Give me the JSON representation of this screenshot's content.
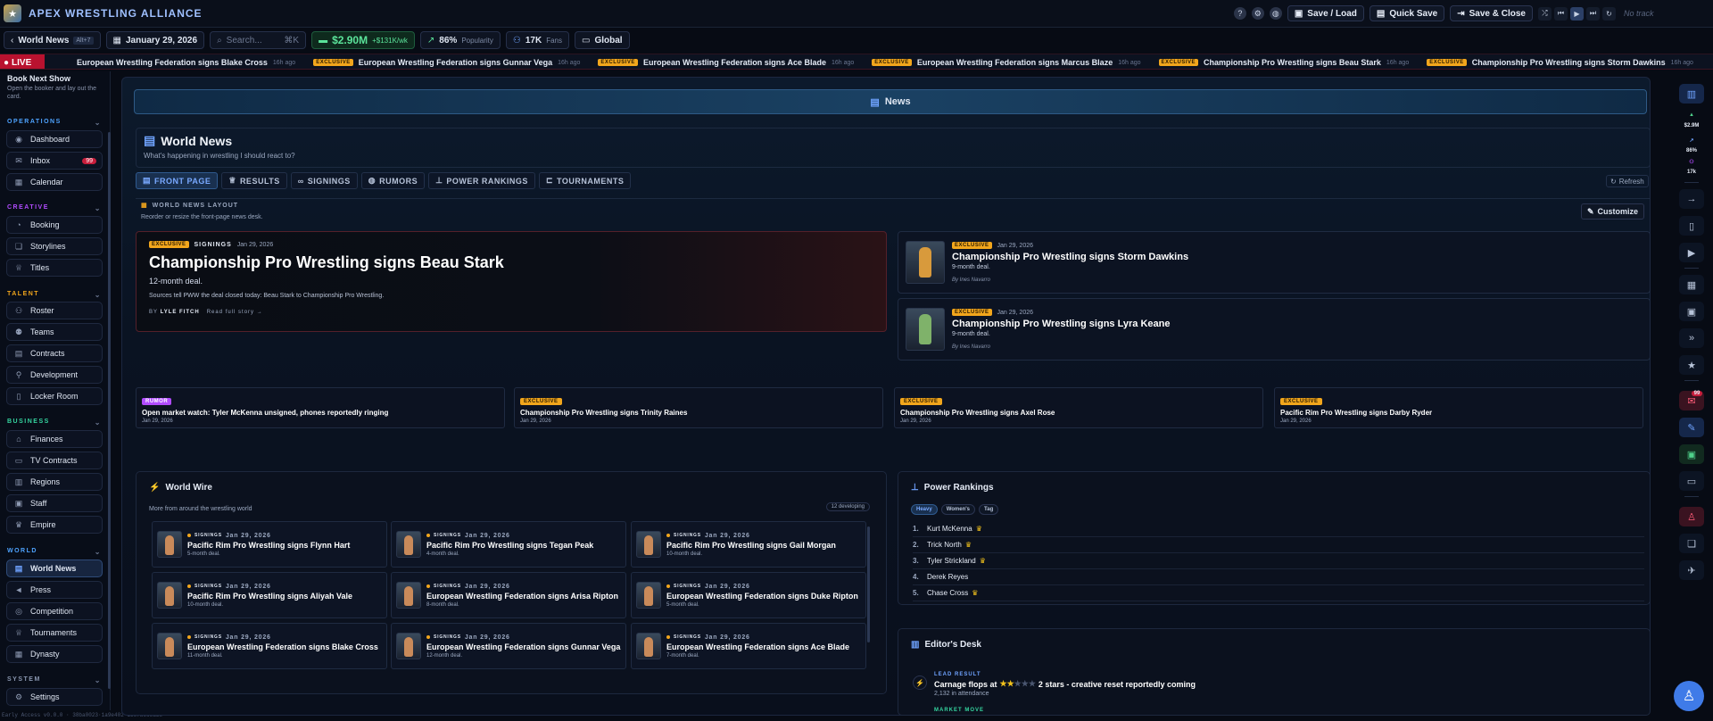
{
  "app": {
    "title": "APEX WRESTLING ALLIANCE"
  },
  "topbar": {
    "save_load": "Save / Load",
    "quick_save": "Quick Save",
    "save_close": "Save & Close",
    "track": "No track"
  },
  "statusbar": {
    "world_news": "World News",
    "shortcut": "Alt+7",
    "date": "January 29, 2026",
    "search_placeholder": "Search...",
    "search_kbd": "⌘K",
    "money": "$2.90M",
    "money_delta": "+$131K/wk",
    "popularity": "86%",
    "popularity_label": "Popularity",
    "fans": "17K",
    "fans_label": "Fans",
    "scope": "Global"
  },
  "ticker": {
    "live": "LIVE",
    "items": [
      {
        "tag": "",
        "text": "European Wrestling Federation signs Blake Cross",
        "ago": "16h ago"
      },
      {
        "tag": "EXCLUSIVE",
        "text": "European Wrestling Federation signs Gunnar Vega",
        "ago": "16h ago"
      },
      {
        "tag": "EXCLUSIVE",
        "text": "European Wrestling Federation signs Ace Blade",
        "ago": "16h ago"
      },
      {
        "tag": "EXCLUSIVE",
        "text": "European Wrestling Federation signs Marcus Blaze",
        "ago": "16h ago"
      },
      {
        "tag": "EXCLUSIVE",
        "text": "Championship Pro Wrestling signs Beau Stark",
        "ago": "16h ago"
      },
      {
        "tag": "EXCLUSIVE",
        "text": "Championship Pro Wrestling signs Storm Dawkins",
        "ago": "16h ago"
      }
    ]
  },
  "sidebar": {
    "book_title": "Book Next Show",
    "book_desc": "Open the booker and lay out the card.",
    "sections": {
      "operations": "OPERATIONS",
      "creative": "CREATIVE",
      "talent": "TALENT",
      "business": "BUSINESS",
      "world": "WORLD",
      "system": "SYSTEM"
    },
    "items": {
      "dashboard": "Dashboard",
      "inbox": "Inbox",
      "inbox_count": "99",
      "calendar": "Calendar",
      "booking": "Booking",
      "storylines": "Storylines",
      "titles": "Titles",
      "roster": "Roster",
      "teams": "Teams",
      "contracts": "Contracts",
      "development": "Development",
      "locker_room": "Locker Room",
      "finances": "Finances",
      "tv_contracts": "TV Contracts",
      "regions": "Regions",
      "staff": "Staff",
      "empire": "Empire",
      "world_news": "World News",
      "press": "Press",
      "competition": "Competition",
      "tournaments": "Tournaments",
      "dynasty": "Dynasty",
      "settings": "Settings"
    },
    "version": "Early Access v0.0.0 · 38ba0023·1a9e402·1387b6c9a38"
  },
  "rail": {
    "money": "$2.9M",
    "pop": "86%",
    "fans": "17k",
    "badge": "99"
  },
  "header": {
    "title": "News"
  },
  "worldnews": {
    "title": "World News",
    "subtitle": "What's happening in wrestling I should react to?",
    "tabs": [
      "FRONT PAGE",
      "RESULTS",
      "SIGNINGS",
      "RUMORS",
      "POWER RANKINGS",
      "TOURNAMENTS"
    ],
    "refresh": "Refresh",
    "layout_title": "WORLD NEWS LAYOUT",
    "layout_sub": "Reorder or resize the front-page news desk.",
    "customize": "Customize"
  },
  "hero": {
    "tag": "EXCLUSIVE",
    "cat": "SIGNINGS",
    "date": "Jan 29, 2026",
    "headline": "Championship Pro Wrestling signs Beau Stark",
    "deal": "12-month deal.",
    "lede": "Sources tell PWW the deal closed today: Beau Stark to Championship Pro Wrestling.",
    "by": "BY",
    "author": "LYLE FITCH",
    "read": "Read full story →"
  },
  "side_stories": [
    {
      "tag": "EXCLUSIVE",
      "date": "Jan 29, 2026",
      "headline": "Championship Pro Wrestling signs Storm Dawkins",
      "deal": "9-month deal.",
      "author": "By Ines Navarro"
    },
    {
      "tag": "EXCLUSIVE",
      "date": "Jan 29, 2026",
      "headline": "Championship Pro Wrestling signs Lyra Keane",
      "deal": "9-month deal.",
      "author": "By Ines Navarro"
    }
  ],
  "mini_stories": [
    {
      "tag": "RUMOR",
      "headline": "Open market watch: Tyler McKenna unsigned, phones reportedly ringing",
      "date": "Jan 29, 2026"
    },
    {
      "tag": "EXCLUSIVE",
      "headline": "Championship Pro Wrestling signs Trinity Raines",
      "date": "Jan 29, 2026"
    },
    {
      "tag": "EXCLUSIVE",
      "headline": "Championship Pro Wrestling signs Axel Rose",
      "date": "Jan 29, 2026"
    },
    {
      "tag": "EXCLUSIVE",
      "headline": "Pacific Rim Pro Wrestling signs Darby Ryder",
      "date": "Jan 29, 2026"
    }
  ],
  "wire": {
    "title": "World Wire",
    "subtitle": "More from around the wrestling world",
    "developing": "12 developing",
    "cards": [
      {
        "cat": "SIGNINGS",
        "date": "Jan 29, 2026",
        "headline": "Pacific Rim Pro Wrestling signs Flynn Hart",
        "deal": "5-month deal."
      },
      {
        "cat": "SIGNINGS",
        "date": "Jan 29, 2026",
        "headline": "Pacific Rim Pro Wrestling signs Tegan Peak",
        "deal": "4-month deal."
      },
      {
        "cat": "SIGNINGS",
        "date": "Jan 29, 2026",
        "headline": "Pacific Rim Pro Wrestling signs Gail Morgan",
        "deal": "10-month deal."
      },
      {
        "cat": "SIGNINGS",
        "date": "Jan 29, 2026",
        "headline": "Pacific Rim Pro Wrestling signs Aliyah Vale",
        "deal": "10-month deal."
      },
      {
        "cat": "SIGNINGS",
        "date": "Jan 29, 2026",
        "headline": "European Wrestling Federation signs Arisa Ripton",
        "deal": "8-month deal."
      },
      {
        "cat": "SIGNINGS",
        "date": "Jan 29, 2026",
        "headline": "European Wrestling Federation signs Duke Ripton",
        "deal": "5-month deal."
      },
      {
        "cat": "SIGNINGS",
        "date": "Jan 29, 2026",
        "headline": "European Wrestling Federation signs Blake Cross",
        "deal": "11-month deal."
      },
      {
        "cat": "SIGNINGS",
        "date": "Jan 29, 2026",
        "headline": "European Wrestling Federation signs Gunnar Vega",
        "deal": "12-month deal."
      },
      {
        "cat": "SIGNINGS",
        "date": "Jan 29, 2026",
        "headline": "European Wrestling Federation signs Ace Blade",
        "deal": "7-month deal."
      }
    ]
  },
  "rankings": {
    "title": "Power Rankings",
    "tabs": [
      "Heavy",
      "Women's",
      "Tag"
    ],
    "items": [
      {
        "n": "1.",
        "name": "Kurt McKenna"
      },
      {
        "n": "2.",
        "name": "Trick North"
      },
      {
        "n": "3.",
        "name": "Tyler Strickland"
      },
      {
        "n": "4.",
        "name": "Derek Reyes"
      },
      {
        "n": "5.",
        "name": "Chase Cross"
      }
    ]
  },
  "editor": {
    "title": "Editor's Desk",
    "lead_label": "LEAD RESULT",
    "lead_pre": "Carnage flops at",
    "lead_post": "2 stars - creative reset reportedly coming",
    "rating": 2,
    "attendance": "2,132 in attendance",
    "next_label": "MARKET MOVE"
  },
  "colors": {
    "accent": "#3f7be8",
    "exclusive": "#f2a61c",
    "rumor": "#b14bff",
    "live": "#b9122f",
    "money": "#5be39a"
  }
}
